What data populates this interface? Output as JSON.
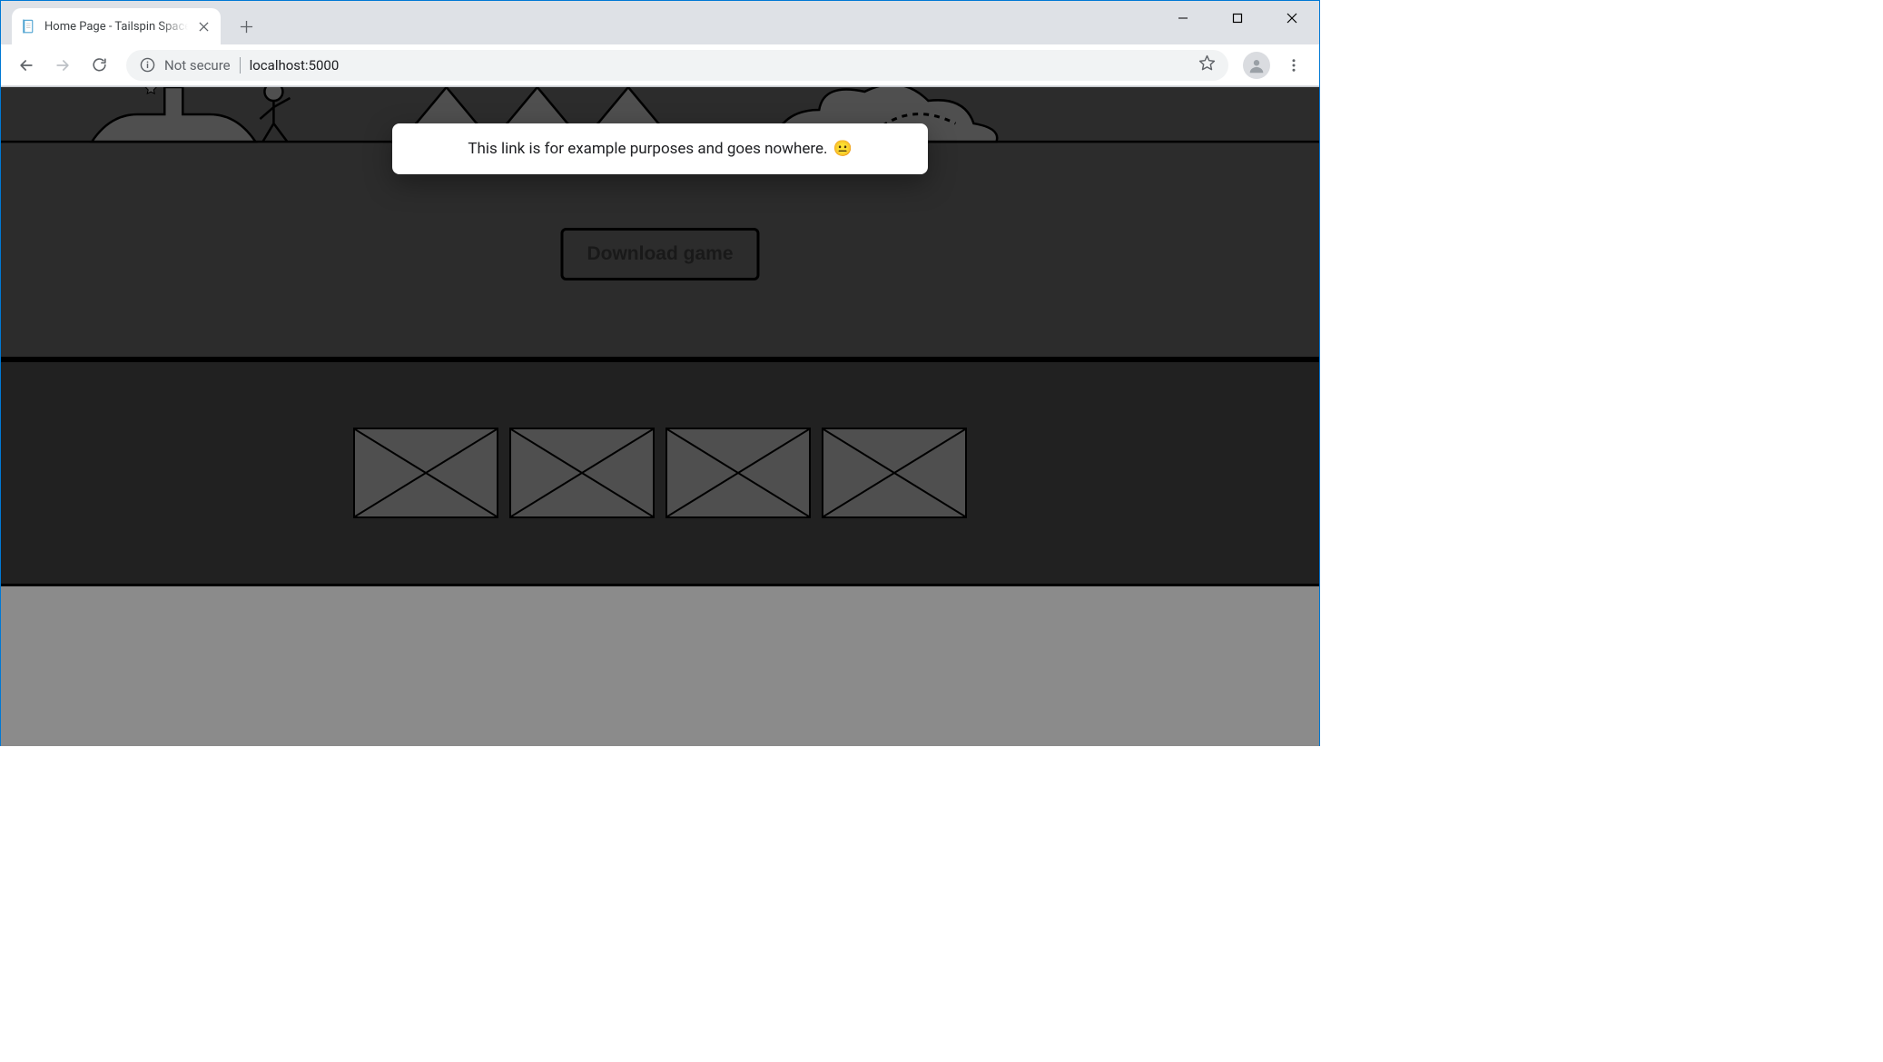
{
  "browser": {
    "tab_title": "Home Page - Tailspin SpaceGame",
    "not_secure_label": "Not secure",
    "url": "localhost:5000"
  },
  "page": {
    "download_button_label": "Download game",
    "toast_message": "This link is for example purposes and goes nowhere.",
    "toast_emoji": "😐"
  }
}
